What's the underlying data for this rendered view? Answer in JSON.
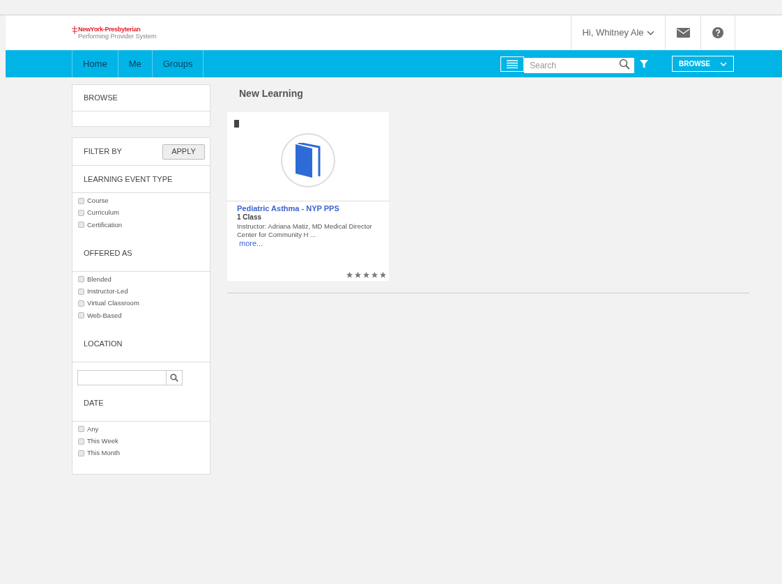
{
  "logo": {
    "title": "NewYork-Presbyterian",
    "subtitle": "Performing Provider System"
  },
  "user_menu": {
    "label": "Hi, Whitney Ale"
  },
  "nav": [
    {
      "label": "Home",
      "selected": false
    },
    {
      "label": "Me",
      "selected": false
    },
    {
      "label": "Groups",
      "selected": false
    }
  ],
  "search": {
    "placeholder": "Search"
  },
  "browse_button": {
    "label": "BROWSE"
  },
  "sidebar": {
    "browse_title": "BROWSE",
    "filter_title": "FILTER BY",
    "apply": "APPLY",
    "sections": [
      {
        "title": "LEARNING EVENT TYPE",
        "kind": "checkboxes",
        "options": [
          {
            "label": "Course",
            "checked": false
          },
          {
            "label": "Curriculum",
            "checked": false
          },
          {
            "label": "Certification",
            "checked": false
          }
        ]
      },
      {
        "title": "OFFERED AS",
        "kind": "checkboxes",
        "options": [
          {
            "label": "Blended",
            "checked": false
          },
          {
            "label": "Instructor-Led",
            "checked": false
          },
          {
            "label": "Virtual Classroom",
            "checked": false
          },
          {
            "label": "Web-Based",
            "checked": false
          }
        ]
      },
      {
        "title": "LOCATION",
        "kind": "search"
      },
      {
        "title": "DATE",
        "kind": "checkboxes",
        "options": [
          {
            "label": "Any",
            "checked": false
          },
          {
            "label": "This Week",
            "checked": false
          },
          {
            "label": "This Month",
            "checked": false
          }
        ]
      }
    ]
  },
  "main": {
    "title": "New Learning",
    "cards": [
      {
        "title": "Pediatric Asthma - NYP PPS",
        "count": "1 Class",
        "description": "Instructor: Adriana Matiz, MD Medical Director Center for Community H ...",
        "more": "more...",
        "stars": 5
      }
    ]
  }
}
